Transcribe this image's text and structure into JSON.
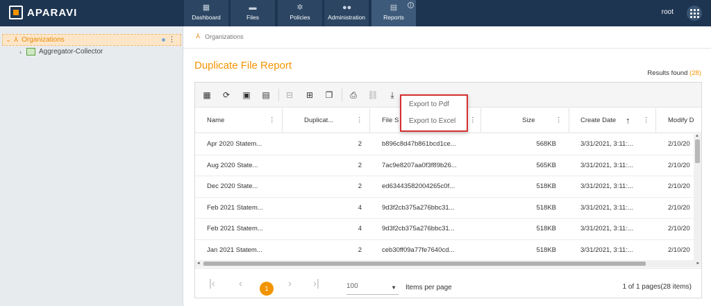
{
  "app": {
    "logo_text": "APARAVI"
  },
  "nav": [
    {
      "label": "Dashboard",
      "icon": "dashboard-icon"
    },
    {
      "label": "Files",
      "icon": "folder-icon"
    },
    {
      "label": "Policies",
      "icon": "gear-icon"
    },
    {
      "label": "Administration",
      "icon": "users-icon"
    },
    {
      "label": "Reports",
      "icon": "clipboard-icon",
      "active": true
    }
  ],
  "user": {
    "name": "root"
  },
  "tree": {
    "root_label": "Organizations",
    "child_label": "Aggregator-Collector"
  },
  "breadcrumb": {
    "label": "Organizations"
  },
  "report": {
    "title": "Duplicate File Report",
    "results_label": "Results found",
    "results_count": "(28)"
  },
  "columns": {
    "name": "Name",
    "duplicates": "Duplicat...",
    "signature": "File S",
    "size": "Size",
    "create_date": "Create Date",
    "modify_date": "Modify D"
  },
  "rows": [
    {
      "name": "Apr 2020 Statem...",
      "dup": "2",
      "sig": "b896c8d47b861bcd1ce...",
      "size": "568KB",
      "created": "3/31/2021, 3:11:...",
      "modified": "2/10/20"
    },
    {
      "name": "Aug 2020 State...",
      "dup": "2",
      "sig": "7ac9e8207aa0f3f89b26...",
      "size": "565KB",
      "created": "3/31/2021, 3:11:...",
      "modified": "2/10/20"
    },
    {
      "name": "Dec 2020 State...",
      "dup": "2",
      "sig": "ed63443582004265c0f...",
      "size": "518KB",
      "created": "3/31/2021, 3:11:...",
      "modified": "2/10/20"
    },
    {
      "name": "Feb 2021 Statem...",
      "dup": "4",
      "sig": "9d3f2cb375a276bbc31...",
      "size": "518KB",
      "created": "3/31/2021, 3:11:...",
      "modified": "2/10/20"
    },
    {
      "name": "Feb 2021 Statem...",
      "dup": "4",
      "sig": "9d3f2cb375a276bbc31...",
      "size": "518KB",
      "created": "3/31/2021, 3:11:...",
      "modified": "2/10/20"
    },
    {
      "name": "Jan 2021 Statem...",
      "dup": "2",
      "sig": "ceb30ff09a77fe7640cd...",
      "size": "518KB",
      "created": "3/31/2021, 3:11:...",
      "modified": "2/10/20"
    }
  ],
  "export_menu": {
    "pdf": "Export to Pdf",
    "excel": "Export to Excel"
  },
  "pager": {
    "current_page": "1",
    "page_size": "100",
    "items_per_page": "Items per page",
    "info": "1 of 1 pages(28 items)"
  },
  "colors": {
    "accent": "#f29400",
    "topbar": "#1d3551",
    "highlight": "#d32f2f"
  }
}
